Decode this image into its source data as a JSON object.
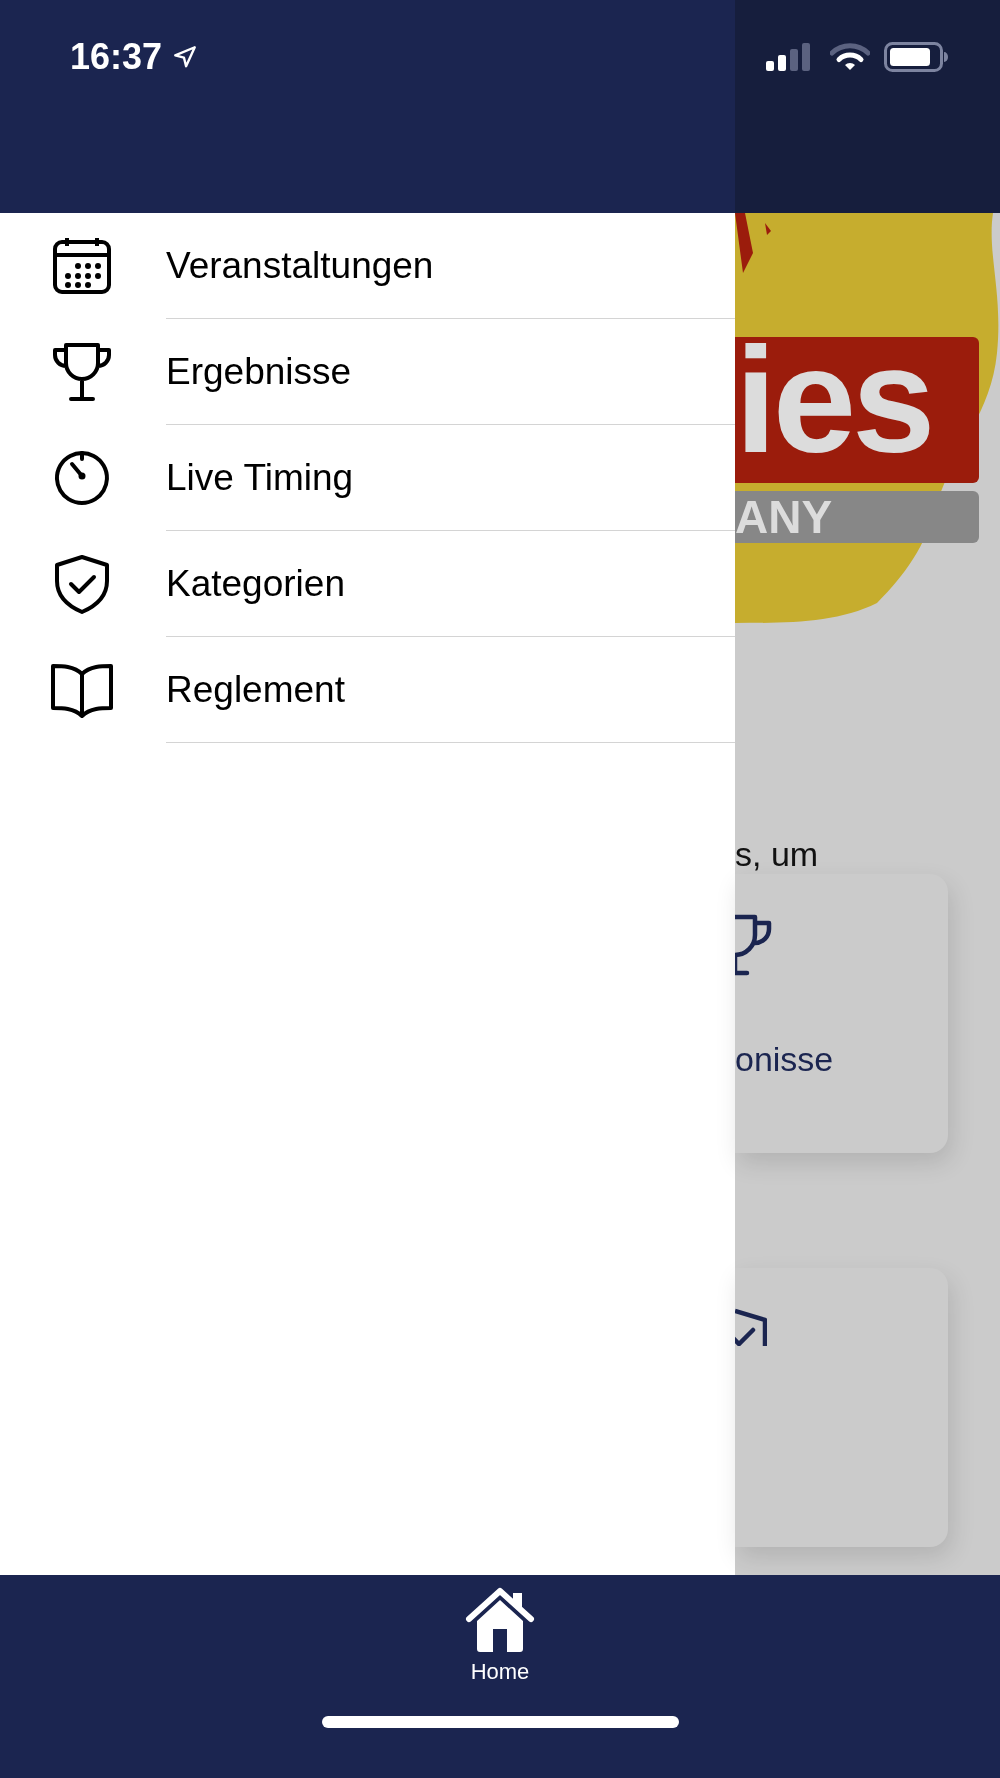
{
  "status_bar": {
    "time": "16:37"
  },
  "drawer": {
    "items": [
      {
        "label": "Veranstaltungen",
        "kind": "calendar"
      },
      {
        "label": "Ergebnisse",
        "kind": "trophy"
      },
      {
        "label": "Live Timing",
        "kind": "timer"
      },
      {
        "label": "Kategorien",
        "kind": "shield"
      },
      {
        "label": "Reglement",
        "kind": "book"
      }
    ]
  },
  "background": {
    "logo": {
      "texts": [
        "ies",
        "ANY"
      ]
    },
    "intro_text": "s, um",
    "cards": [
      {
        "kind": "trophy",
        "label": "onisse"
      },
      {
        "kind": "shield"
      }
    ]
  },
  "tab_bar": {
    "tabs": [
      {
        "label": "Home",
        "selected": true
      }
    ]
  }
}
